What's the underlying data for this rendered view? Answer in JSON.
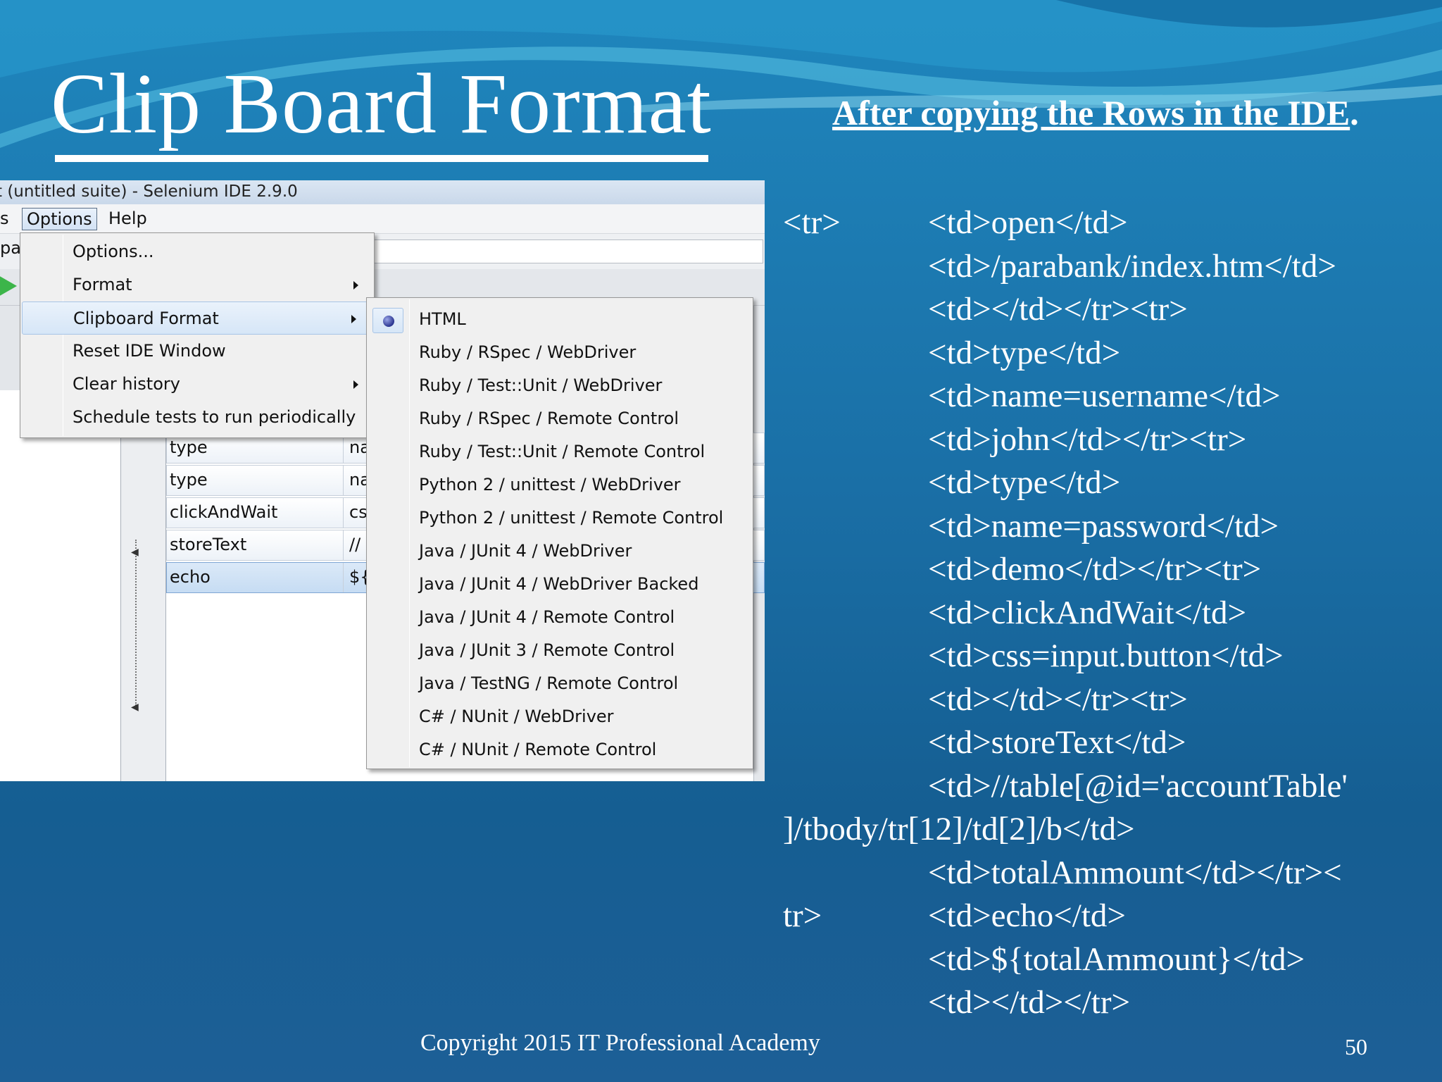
{
  "slide": {
    "title": "Clip Board Format",
    "subtitle_main": "After copying the Rows in the IDE",
    "subtitle_end": ".",
    "code_lines": [
      {
        "lead": "<tr>",
        "text": "<td>open</td>"
      },
      {
        "lead": "",
        "text": "<td>/parabank/index.htm</td>"
      },
      {
        "lead": "",
        "text": "<td></td></tr><tr>"
      },
      {
        "lead": "",
        "text": "<td>type</td>"
      },
      {
        "lead": "",
        "text": "<td>name=username</td>"
      },
      {
        "lead": "",
        "text": "<td>john</td></tr><tr>"
      },
      {
        "lead": "",
        "text": "<td>type</td>"
      },
      {
        "lead": "",
        "text": "<td>name=password</td>"
      },
      {
        "lead": "",
        "text": "<td>demo</td></tr><tr>"
      },
      {
        "lead": "",
        "text": "<td>clickAndWait</td>"
      },
      {
        "lead": "",
        "text": "<td>css=input.button</td>"
      },
      {
        "lead": "",
        "text": "<td></td></tr><tr>"
      },
      {
        "lead": "",
        "text": "<td>storeText</td>"
      },
      {
        "lead": "",
        "text": "<td>//table[@id='accountTable'"
      },
      {
        "lead": "]/tbody/tr[12]/td[2]/b</td>",
        "text": ""
      },
      {
        "lead": "",
        "text": "<td>totalAmmount</td></tr><"
      },
      {
        "lead": "tr>",
        "text": "<td>echo</td>"
      },
      {
        "lead": "",
        "text": "<td>${totalAmmount}</td>"
      },
      {
        "lead": "",
        "text": "<td></td></tr>"
      }
    ],
    "footer": "Copyright 2015 IT Professional Academy",
    "page_number": "50"
  },
  "ide": {
    "window_title": "t (untitled suite) - Selenium IDE 2.9.0",
    "menubar": {
      "partial": "s",
      "options": "Options",
      "help": "Help"
    },
    "base_url_partial": "pa",
    "commands": [
      {
        "command": "type",
        "target": "na"
      },
      {
        "command": "type",
        "target": "na"
      },
      {
        "command": "clickAndWait",
        "target": "cs"
      },
      {
        "command": "storeText",
        "target": "//"
      },
      {
        "command": "echo",
        "target": "${"
      }
    ],
    "options_menu": [
      {
        "label": "Options...",
        "submenu": false
      },
      {
        "label": "Format",
        "submenu": true
      },
      {
        "label": "Clipboard Format",
        "submenu": true
      },
      {
        "label": "Reset IDE Window",
        "submenu": false
      },
      {
        "label": "Clear history",
        "submenu": true
      },
      {
        "label": "Schedule tests to run periodically",
        "submenu": false
      }
    ],
    "clipboard_formats": [
      "HTML",
      "Ruby / RSpec / WebDriver",
      "Ruby / Test::Unit / WebDriver",
      "Ruby / RSpec / Remote Control",
      "Ruby / Test::Unit / Remote Control",
      "Python 2 / unittest / WebDriver",
      "Python 2 / unittest / Remote Control",
      "Java / JUnit 4 / WebDriver",
      "Java / JUnit 4 / WebDriver Backed",
      "Java / JUnit 4 / Remote Control",
      "Java / JUnit 3 / Remote Control",
      "Java / TestNG / Remote Control",
      "C# / NUnit / WebDriver",
      "C# / NUnit / Remote Control"
    ],
    "selected_format": "HTML"
  }
}
